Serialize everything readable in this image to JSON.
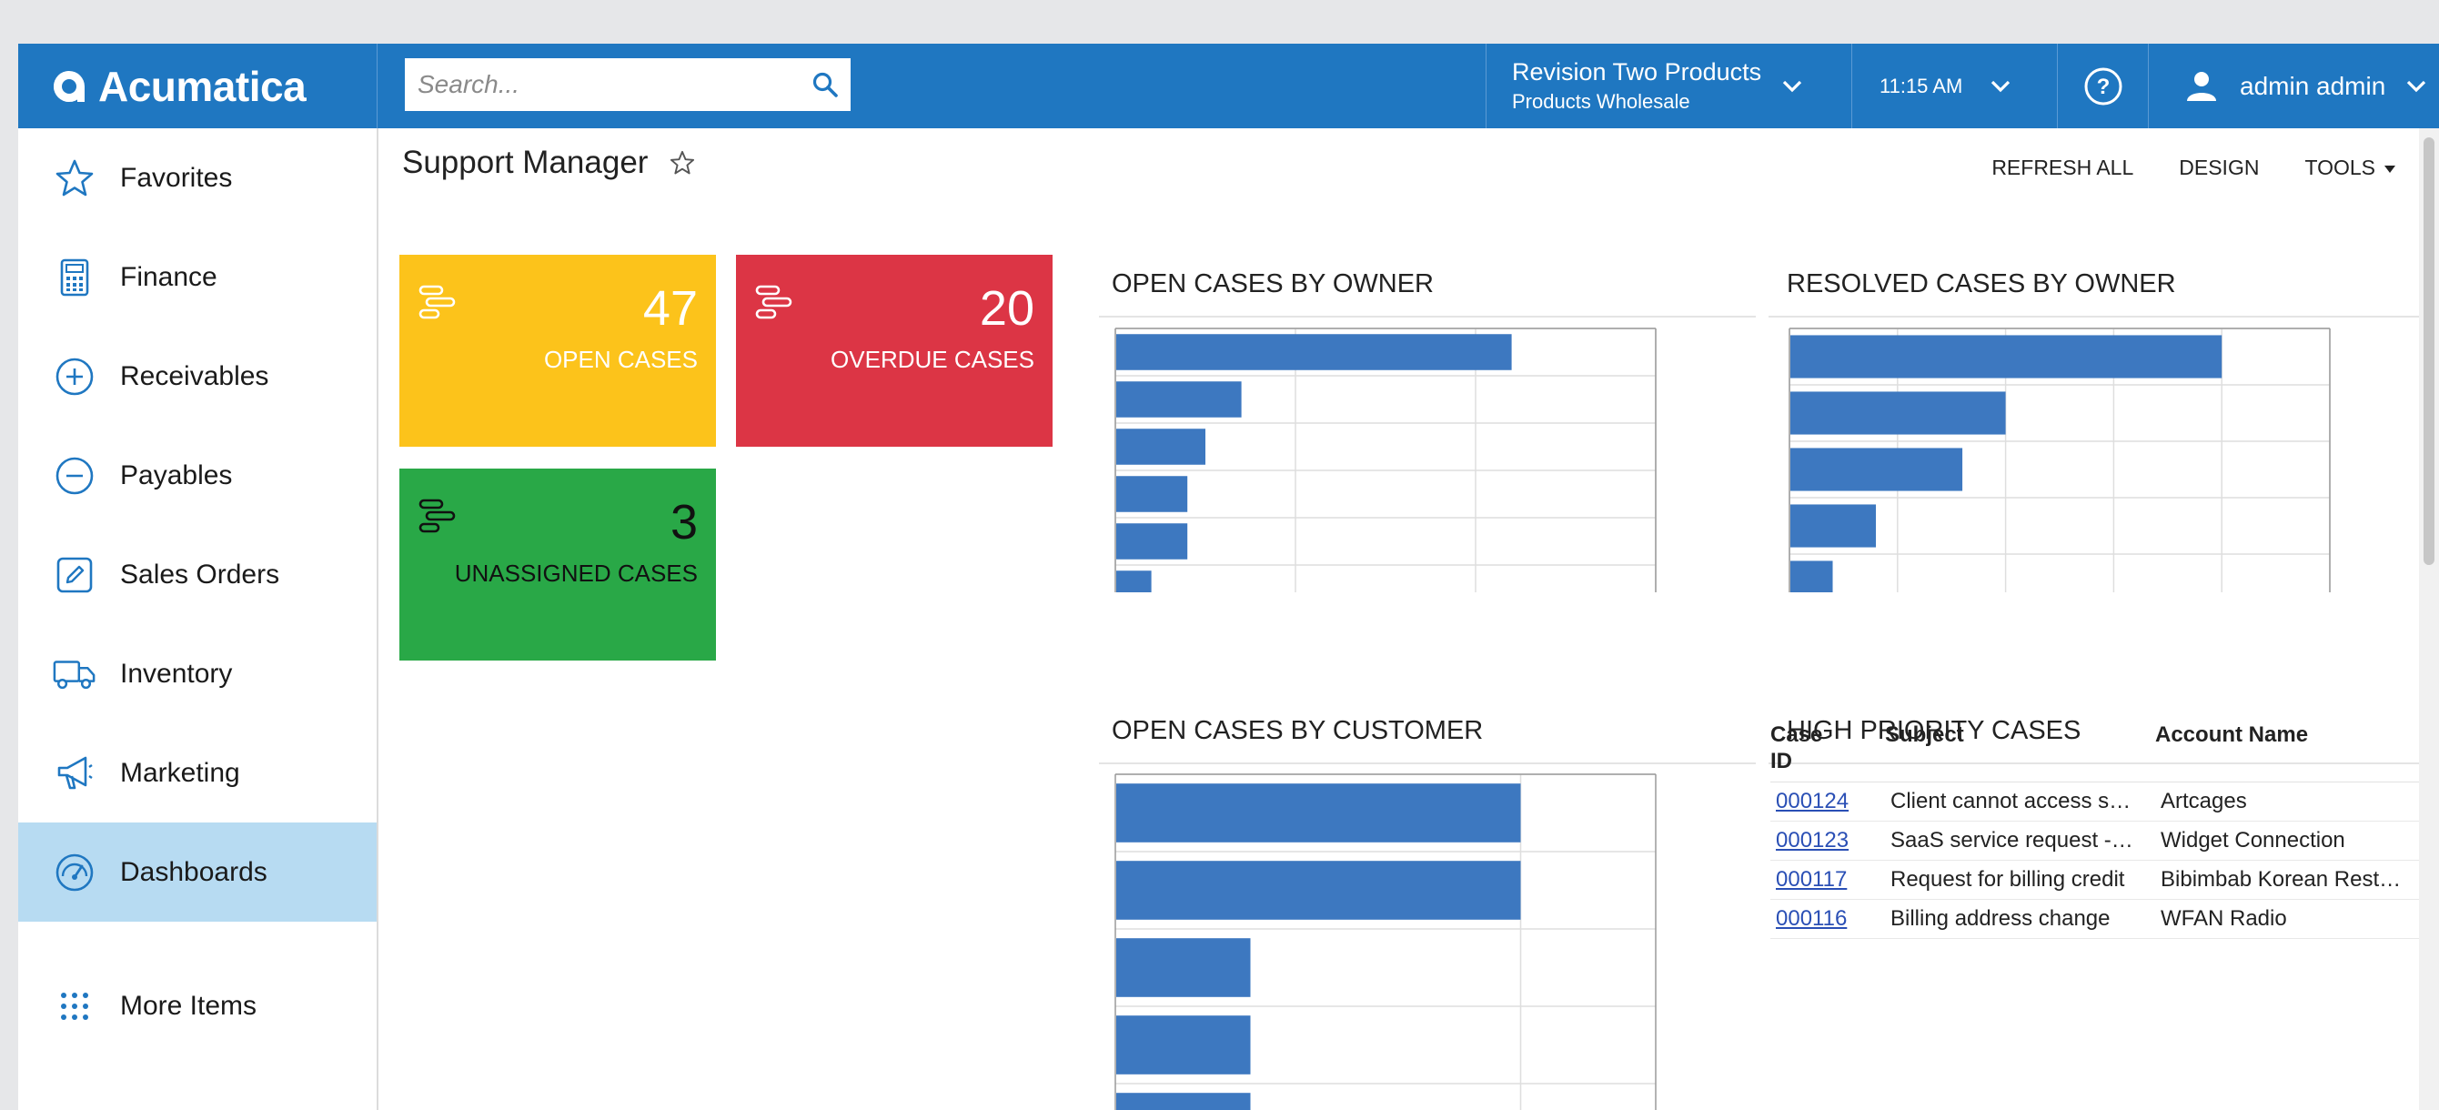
{
  "brand": {
    "name": "Acumatica"
  },
  "topbar": {
    "search_placeholder": "Search...",
    "company": {
      "name": "Revision Two Products",
      "branch": "Products Wholesale"
    },
    "time": "11:15 AM",
    "user": "admin admin"
  },
  "sidebar": {
    "items": [
      {
        "label": "Favorites",
        "icon": "star-icon"
      },
      {
        "label": "Finance",
        "icon": "calculator-icon"
      },
      {
        "label": "Receivables",
        "icon": "plus-circle-icon"
      },
      {
        "label": "Payables",
        "icon": "minus-circle-icon"
      },
      {
        "label": "Sales Orders",
        "icon": "edit-icon"
      },
      {
        "label": "Inventory",
        "icon": "truck-icon"
      },
      {
        "label": "Marketing",
        "icon": "megaphone-icon"
      },
      {
        "label": "Dashboards",
        "icon": "gauge-icon",
        "active": true
      },
      {
        "label": "More Items",
        "icon": "grid-dots-icon"
      }
    ]
  },
  "page": {
    "title": "Support Manager",
    "actions": {
      "refresh": "REFRESH ALL",
      "design": "DESIGN",
      "tools": "TOOLS"
    }
  },
  "tiles": {
    "open": {
      "value": "47",
      "label": "OPEN CASES",
      "color": "#fcc31b"
    },
    "overdue": {
      "value": "20",
      "label": "OVERDUE CASES",
      "color": "#dc3545"
    },
    "unassigned": {
      "value": "3",
      "label": "UNASSIGNED CASES",
      "color": "#29a847"
    }
  },
  "widgets": {
    "open_by_owner": "OPEN CASES BY OWNER",
    "resolved_by_owner": "RESOLVED CASES BY OWNER",
    "open_by_customer": "OPEN CASES BY CUSTOMER",
    "high_priority": "HIGH PRIORITY CASES"
  },
  "chart_data": [
    {
      "type": "bar",
      "orientation": "horizontal",
      "title": "OPEN CASES BY OWNER",
      "values": [
        22,
        7,
        5,
        4,
        4,
        2
      ],
      "xlim": [
        0,
        30
      ],
      "xticks": [
        "0",
        "10",
        "20",
        "30"
      ],
      "color": "#3d78c0",
      "grid": true
    },
    {
      "type": "bar",
      "orientation": "horizontal",
      "title": "RESOLVED CASES BY OWNER",
      "values": [
        20,
        10,
        8,
        4,
        2
      ],
      "xlim": [
        0,
        25
      ],
      "xticks": [
        "0",
        "5",
        "10",
        "15",
        "20",
        "25"
      ],
      "color": "#3d78c0",
      "grid": true
    },
    {
      "type": "bar",
      "orientation": "horizontal",
      "title": "OPEN CASES BY CUSTOMER",
      "values": [
        9,
        9,
        3,
        3,
        3
      ],
      "xlim": [
        0,
        12
      ],
      "color": "#3d78c0",
      "grid": true
    }
  ],
  "high_priority_table": {
    "columns": [
      "Case ID",
      "Subject",
      "Account Name"
    ],
    "rows": [
      {
        "id": "000124",
        "subject": "Client cannot access s…",
        "account": "Artcages"
      },
      {
        "id": "000123",
        "subject": "SaaS service request -…",
        "account": "Widget Connection"
      },
      {
        "id": "000117",
        "subject": "Request for billing credit",
        "account": "Bibimbab Korean Rest…"
      },
      {
        "id": "000116",
        "subject": "Billing address change",
        "account": "WFAN Radio"
      }
    ]
  }
}
